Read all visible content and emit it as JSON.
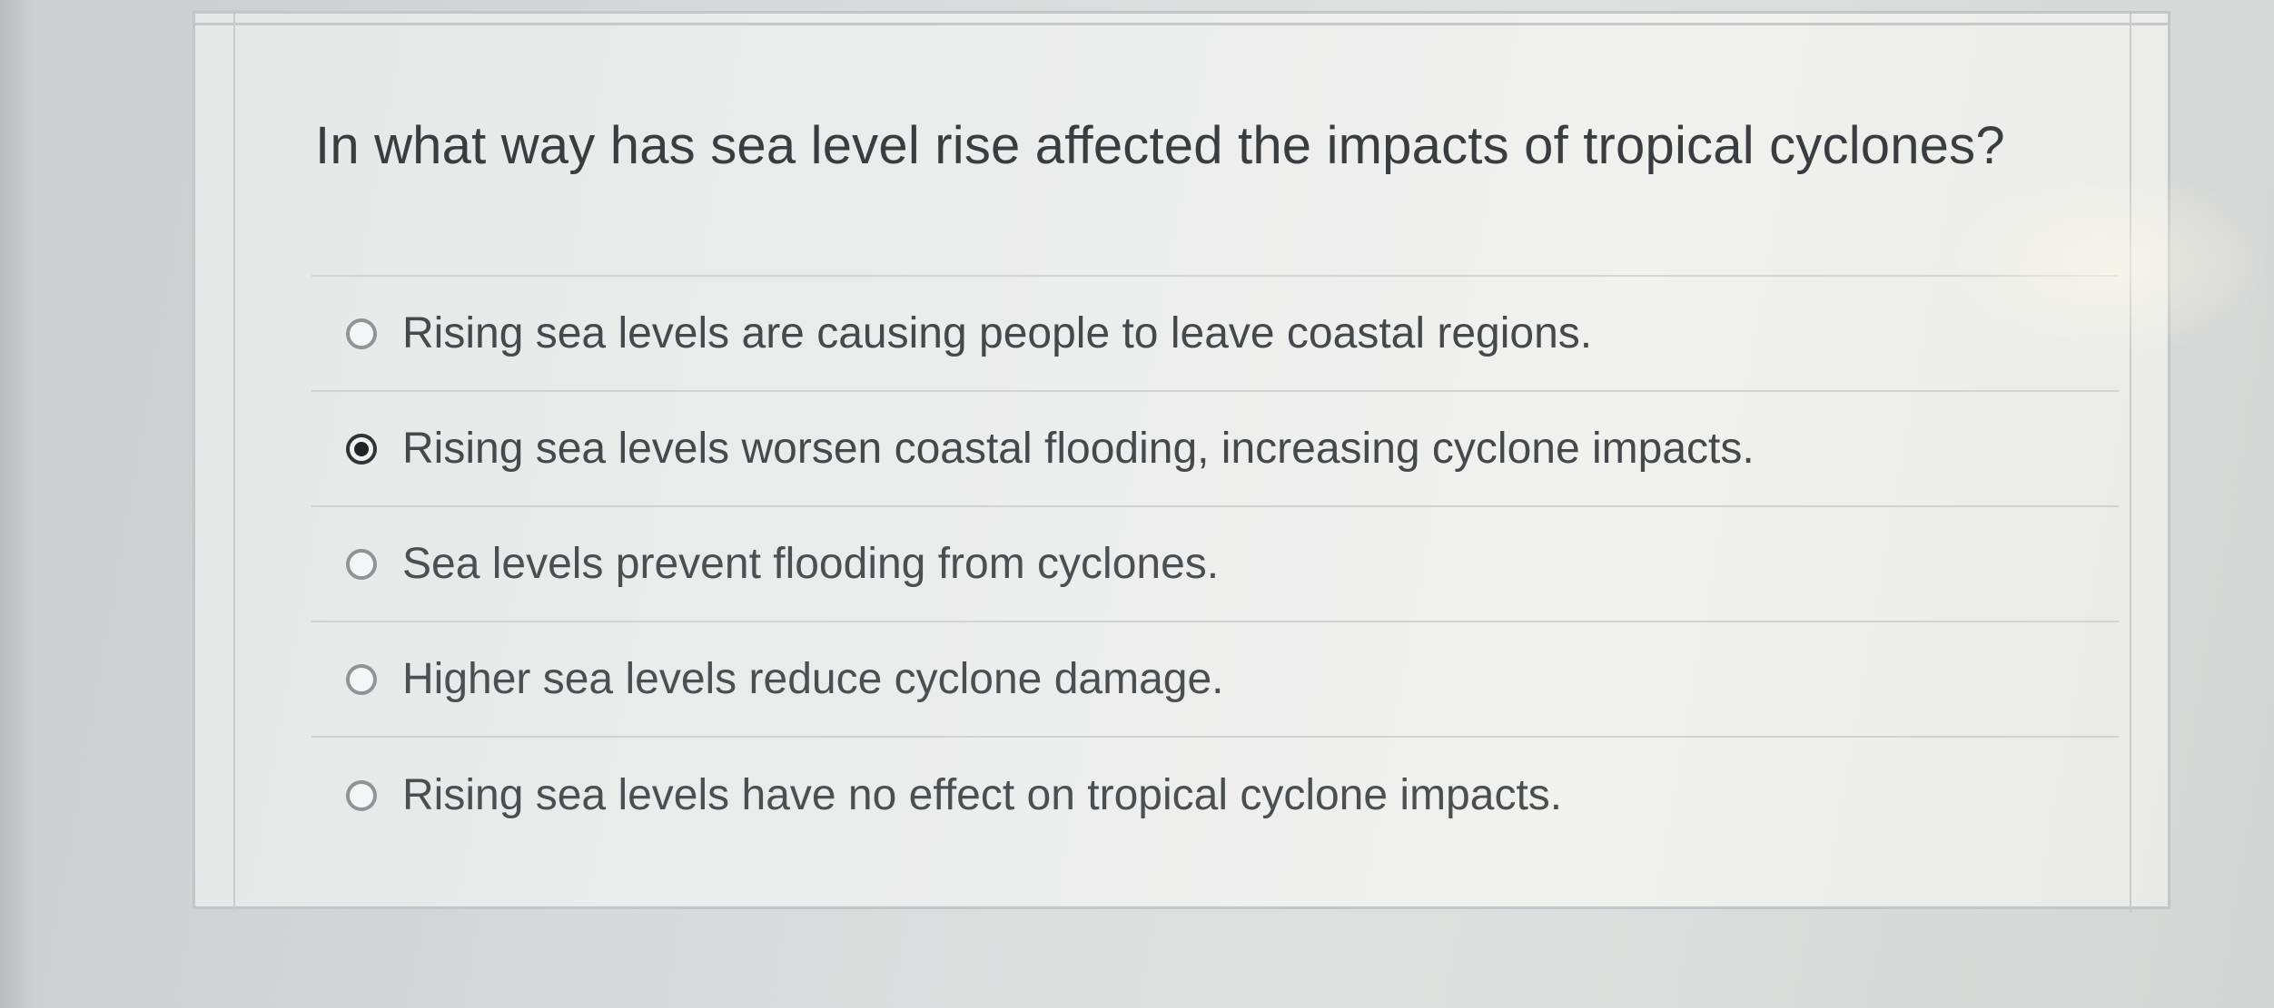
{
  "question": {
    "text": "In what way has sea level rise affected the impacts of tropical cyclones?"
  },
  "options": [
    {
      "label": "Rising sea levels are causing people to leave coastal regions.",
      "selected": false
    },
    {
      "label": "Rising sea levels worsen coastal flooding, increasing cyclone impacts.",
      "selected": true
    },
    {
      "label": "Sea levels prevent flooding from cyclones.",
      "selected": false
    },
    {
      "label": "Higher sea levels reduce cyclone damage.",
      "selected": false
    },
    {
      "label": "Rising sea levels have no effect on tropical cyclone impacts.",
      "selected": false
    }
  ],
  "colors": {
    "selected_radio": "#1f2326",
    "text": "#3a3d40"
  }
}
